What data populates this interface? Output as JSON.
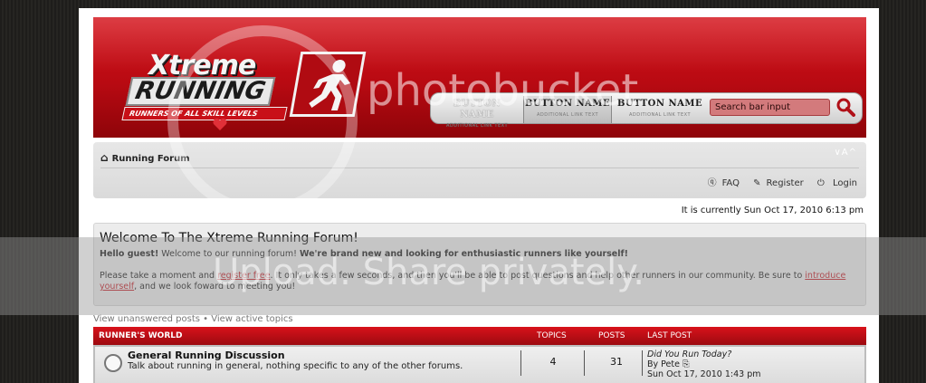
{
  "header": {
    "logo_word": "Xtreme",
    "logo_word2": "RUNNING",
    "tagline": "RUNNERS OF ALL SKILL LEVELS",
    "nav": [
      {
        "name": "BUTTON NAME",
        "sub": "ADDITIONAL LINK TEXT"
      },
      {
        "name": "BUTTON NAME",
        "sub": "ADDITIONAL LINK TEXT"
      },
      {
        "name": "BUTTON NAME",
        "sub": "ADDITIONAL LINK TEXT"
      }
    ],
    "search_placeholder": "Search bar input"
  },
  "breadcrumb": {
    "home": "Running Forum",
    "font_size_control": "∨A^",
    "faq": "FAQ",
    "register": "Register",
    "login": "Login"
  },
  "current_time": "It is currently Sun Oct 17, 2010 6:13 pm",
  "welcome": {
    "title": "Welcome To The Xtreme Running Forum!",
    "hello_bold": "Hello guest!",
    "hello_text": " Welcome to our running forum! ",
    "hello_bold2": "We're brand new and looking for enthusiastic runners like yourself!",
    "p2_a": "Please take a moment and ",
    "p2_link1": "register free",
    "p2_b": ". It only takes a few seconds, and then you'll be able to post questions and help other runners in our community. Be sure to ",
    "p2_link2": "introduce yourself",
    "p2_c": ", and we look foward to meeting you!"
  },
  "quick_links": "View unanswered posts • View active topics",
  "forum_table": {
    "category": "RUNNER'S WORLD",
    "col_topics": "TOPICS",
    "col_posts": "POSTS",
    "col_lastpost": "LAST POST",
    "rows": [
      {
        "title": "General Running Discussion",
        "desc": "Talk about running in general, nothing specific to any of the other forums.",
        "topics": "4",
        "posts": "31",
        "last_title": "Did You Run Today?",
        "last_by": "By Pete",
        "last_date": "Sun Oct 17, 2010 1:43 pm"
      }
    ]
  },
  "watermark": {
    "text1": "photobucket",
    "text2": "Upload. Share privately."
  },
  "colors": {
    "brand_red": "#c80e16",
    "link_red": "#c0121b",
    "bg": "#1b1a18"
  }
}
